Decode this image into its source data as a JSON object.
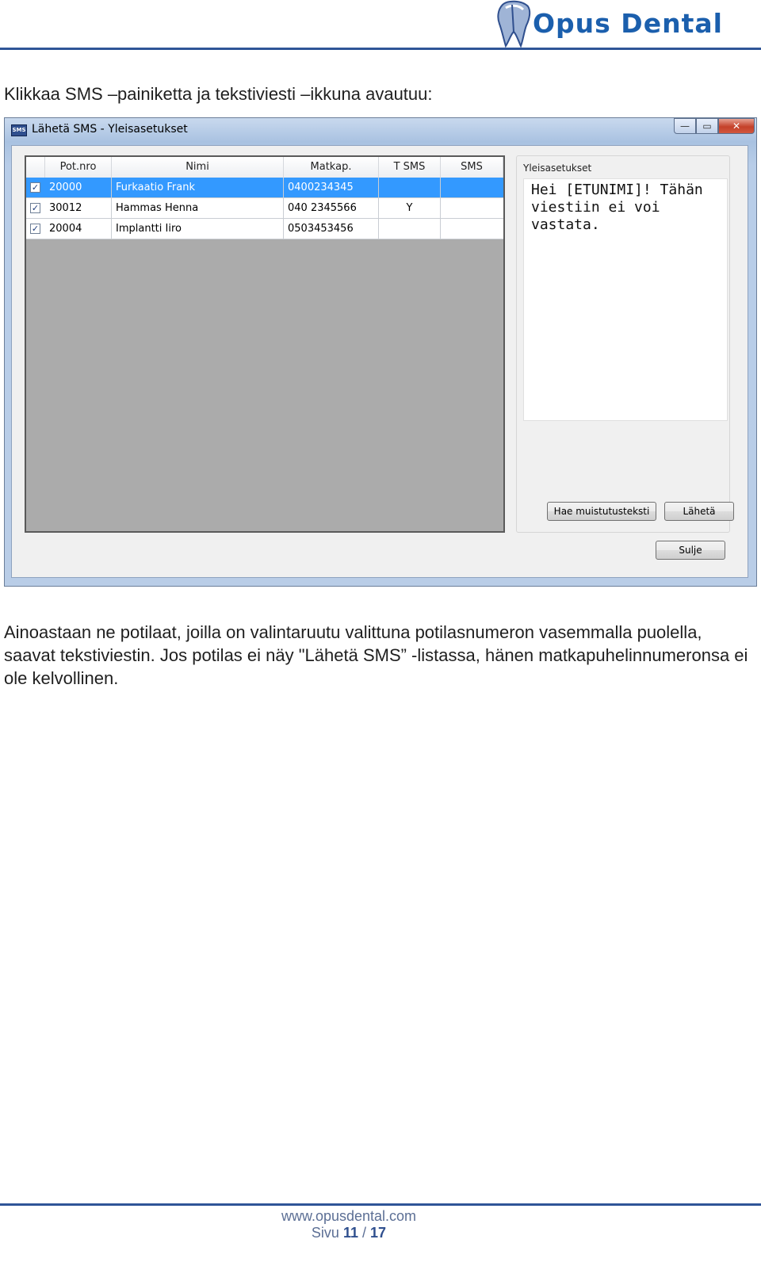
{
  "header": {
    "logo_text": "Opus Dental"
  },
  "intro_text": "Klikkaa SMS –painiketta ja tekstiviesti –ikkuna avautuu:",
  "window": {
    "title": "Lähetä SMS - Yleisasetukset",
    "icon_text": "SMS",
    "controls": {
      "minimize": "—",
      "maximize": "▭",
      "close": "✕"
    },
    "columns": [
      "Pot.nro",
      "Nimi",
      "Matkap.",
      "T SMS",
      "SMS"
    ],
    "rows": [
      {
        "checked": true,
        "selected": true,
        "pot_nro": "20000",
        "nimi": "Furkaatio Frank",
        "matkap": "0400234345",
        "t_sms": "",
        "sms": ""
      },
      {
        "checked": true,
        "selected": false,
        "pot_nro": "30012",
        "nimi": "Hammas Henna",
        "matkap": "040 2345566",
        "t_sms": "Y",
        "sms": ""
      },
      {
        "checked": true,
        "selected": false,
        "pot_nro": "20004",
        "nimi": "Implantti Iiro",
        "matkap": "0503453456",
        "t_sms": "",
        "sms": ""
      }
    ],
    "checkmark": "✓",
    "group_label": "Yleisasetukset",
    "message": "Hei [ETUNIMI]! Tähän\nviestiin ei voi vastata.",
    "buttons": {
      "fetch": "Hae muistutusteksti",
      "send": "Lähetä",
      "close": "Sulje"
    }
  },
  "paragraph": "Ainoastaan ne potilaat, joilla on valintaruutu valittuna potilasnumeron vasemmalla puolella, saavat tekstiviestin. Jos potilas ei näy \"Lähetä SMS” -listassa, hänen matkapuhelinnumeronsa ei ole kelvollinen.",
  "footer": {
    "url": "www.opusdental.com",
    "page_prefix": "Sivu",
    "page_current": "11",
    "page_sep": "/",
    "page_total": "17"
  },
  "colors": {
    "accent": "#2f5597",
    "selection": "#3399ff",
    "logo": "#1b5fad"
  }
}
